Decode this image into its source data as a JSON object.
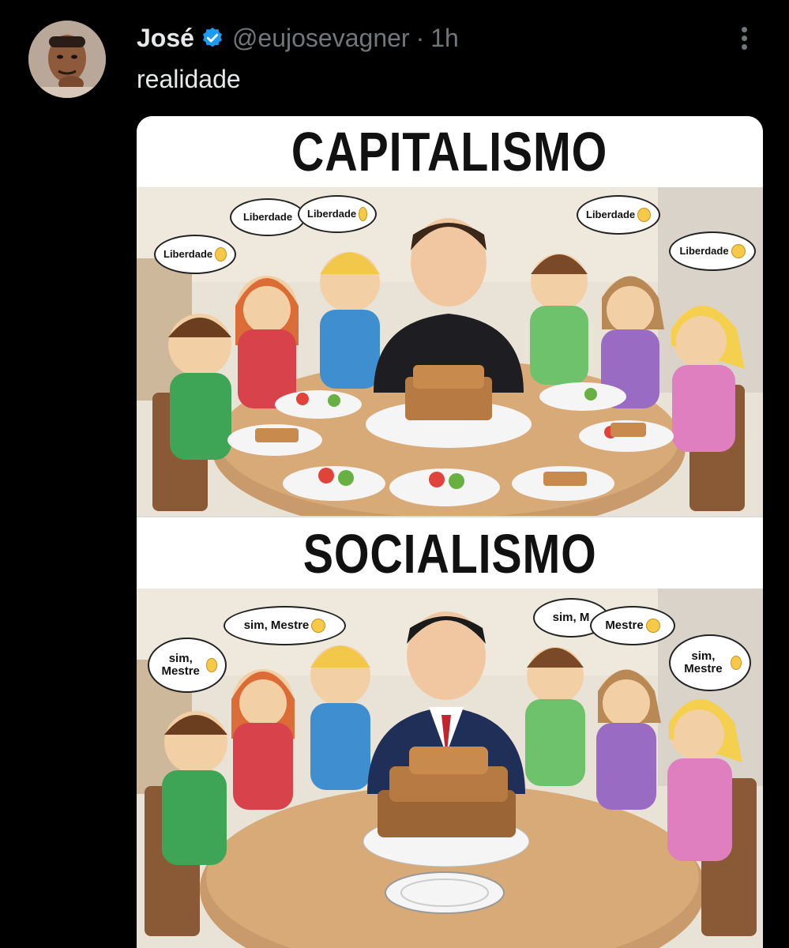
{
  "tweet": {
    "author_name": "José",
    "handle": "@eujosevagner",
    "separator": "·",
    "time": "1h",
    "text": "realidade",
    "verified_color": "#1d9bf0"
  },
  "meme": {
    "top": {
      "title": "CAPITALISMO",
      "bubbles": [
        "Liberdade",
        "Liberdade",
        "Liberdade",
        "Liberdade",
        "Liberdade"
      ]
    },
    "bottom": {
      "title": "SOCIALISMO",
      "bubbles": [
        "sim, Mestre",
        "sim, Mestre",
        "sim, M",
        "Mestre",
        "sim, Mestre"
      ]
    }
  }
}
